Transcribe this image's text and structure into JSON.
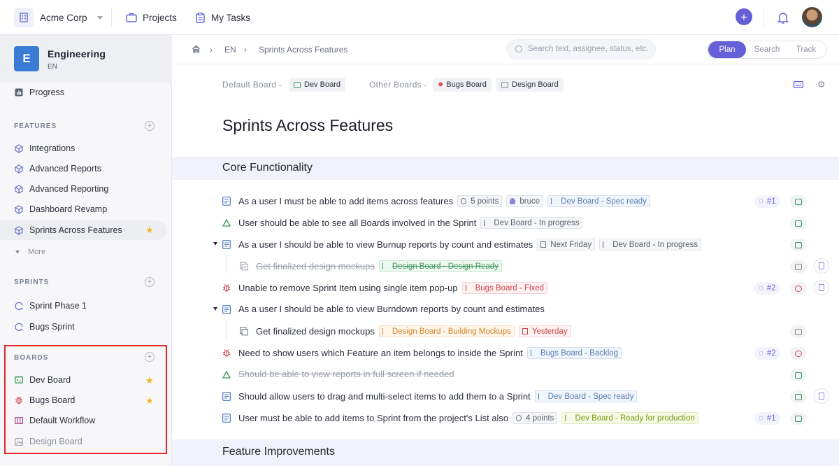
{
  "topbar": {
    "org_name": "Acme Corp",
    "nav": [
      {
        "label": "Projects",
        "icon": "briefcase-icon"
      },
      {
        "label": "My Tasks",
        "icon": "clipboard-icon"
      }
    ],
    "add_icon": "plus-icon",
    "bell_icon": "bell-icon",
    "accent_color": "#6560d8"
  },
  "sidebar": {
    "workspace": {
      "initial": "E",
      "name": "Engineering",
      "sub": "EN"
    },
    "progress_label": "Progress",
    "features_header": "FEATURES",
    "features": [
      {
        "label": "Integrations"
      },
      {
        "label": "Advanced Reports"
      },
      {
        "label": "Advanced Reporting"
      },
      {
        "label": "Dashboard Revamp"
      },
      {
        "label": "Sprints Across Features",
        "starred": true,
        "active": true
      }
    ],
    "more_label": "More",
    "sprints_header": "SPRINTS",
    "sprints": [
      {
        "label": "Sprint Phase 1"
      },
      {
        "label": "Bugs Sprint"
      }
    ],
    "boards_header": "BOARDS",
    "boards": [
      {
        "label": "Dev Board",
        "starred": true,
        "color": "#3a9658"
      },
      {
        "label": "Bugs Board",
        "starred": true,
        "color": "#d34b4f"
      },
      {
        "label": "Default Workflow",
        "color": "#b04f9c"
      },
      {
        "label": "Design Board",
        "color": "#9a9aa0"
      }
    ]
  },
  "breadcrumb": {
    "level1": "EN",
    "level2": "Sprints Across Features"
  },
  "search": {
    "placeholder": "Search text, assignee, status, etc."
  },
  "modes": {
    "plan": "Plan",
    "search": "Search",
    "track": "Track",
    "active": "Plan"
  },
  "boards_bar": {
    "default_label": "Default Board -",
    "default_board": "Dev Board",
    "other_label": "Other Boards -",
    "other_boards": [
      "Bugs Board",
      "Design Board"
    ]
  },
  "page_title": "Sprints Across Features",
  "sections": [
    {
      "title": "Core Functionality",
      "items": [
        {
          "text": "As a user I must be able to add items across features",
          "tags": [
            "5 points",
            "bruce",
            "Dev Board - Spec ready"
          ],
          "ref": "#1"
        },
        {
          "text": "User should be able to see all Boards involved in the Sprint",
          "tags": [
            "Dev Board - In progress"
          ]
        },
        {
          "text": "As a user I should be able to view Burnup reports by count and estimates",
          "tags": [
            "Next Friday",
            "Dev Board - In progress"
          ],
          "children": [
            {
              "text": "Get finalized design mockups",
              "tags": [
                "Design Board - Design Ready"
              ],
              "done": true
            }
          ]
        },
        {
          "text": "Unable to remove Sprint Item using single item pop-up",
          "tags": [
            "Bugs Board - Fixed"
          ],
          "ref": "#2"
        },
        {
          "text": "As a user I should be able to view Burndown reports by count and estimates",
          "tags": [],
          "children": [
            {
              "text": "Get finalized design mockups",
              "tags": [
                "Design Board - Building Mockups",
                "Yesterday"
              ]
            }
          ]
        },
        {
          "text": "Need to show users which Feature an item belongs to inside the Sprint",
          "tags": [
            "Bugs Board - Backlog"
          ],
          "ref": "#2"
        },
        {
          "text": "Should be able to view reports in full screen if needed",
          "tags": [],
          "done": true
        },
        {
          "text": "Should allow users to drag and multi-select items to add them to a Sprint",
          "tags": [
            "Dev Board - Spec ready"
          ]
        },
        {
          "text": "User must be able to add items to Sprint from the project's List also",
          "tags": [
            "4 points",
            "Dev Board - Ready for production"
          ],
          "ref": "#1"
        }
      ]
    },
    {
      "title": "Feature Improvements",
      "items": []
    }
  ]
}
